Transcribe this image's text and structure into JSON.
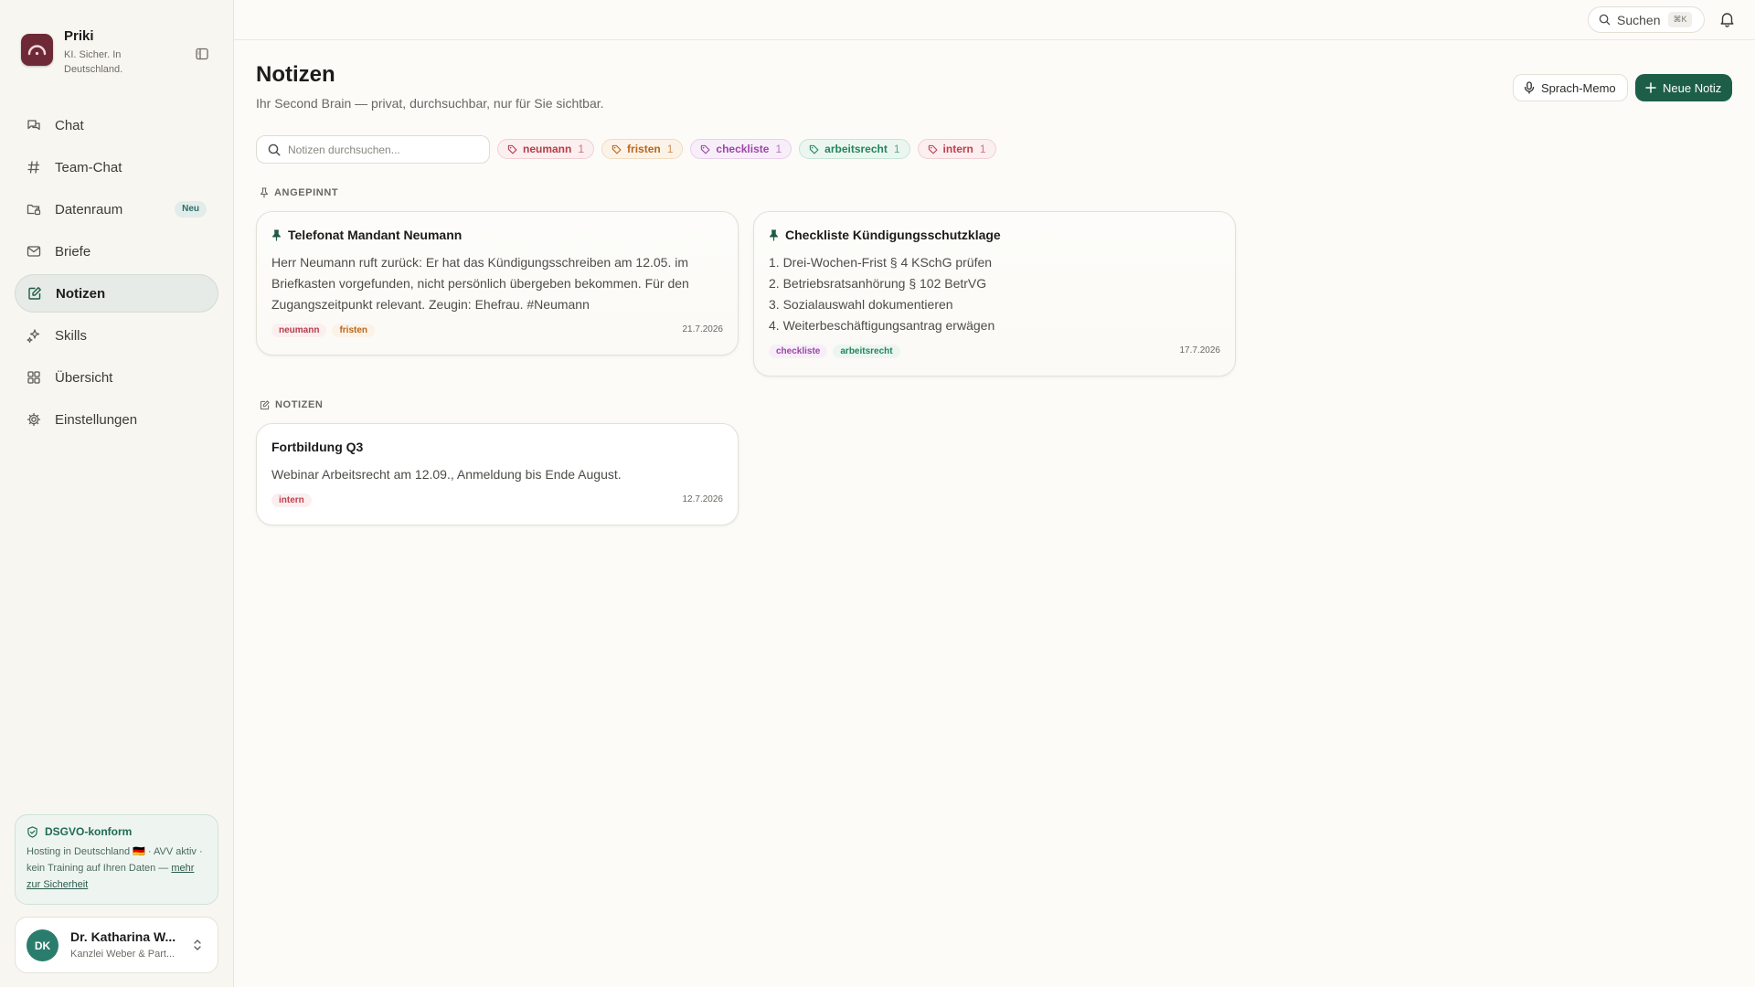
{
  "app": {
    "name": "Priki",
    "tagline": "KI. Sicher. In Deutschland."
  },
  "sidebar": {
    "items": [
      {
        "label": "Chat",
        "icon": "chat-icon"
      },
      {
        "label": "Team-Chat",
        "icon": "hash-icon"
      },
      {
        "label": "Datenraum",
        "icon": "folder-icon",
        "badge": "Neu"
      },
      {
        "label": "Briefe",
        "icon": "mail-icon"
      },
      {
        "label": "Notizen",
        "icon": "edit-note-icon",
        "active": true
      },
      {
        "label": "Skills",
        "icon": "sparkle-icon"
      },
      {
        "label": "Übersicht",
        "icon": "grid-icon"
      },
      {
        "label": "Einstellungen",
        "icon": "gear-icon"
      }
    ],
    "gdpr": {
      "title": "DSGVO-konform",
      "text": "Hosting in Deutschland 🇩🇪 · AVV aktiv · kein Training auf Ihren Daten —",
      "link": "mehr zur Sicherheit"
    },
    "user": {
      "initials": "DK",
      "name": "Dr. Katharina W...",
      "org": "Kanzlei Weber & Part..."
    }
  },
  "topbar": {
    "search_label": "Suchen",
    "search_shortcut": "⌘K"
  },
  "page": {
    "title": "Notizen",
    "subtitle": "Ihr Second Brain — privat, durchsuchbar, nur für Sie sichtbar.",
    "voice_button": "Sprach-Memo",
    "new_button": "Neue Notiz",
    "search_placeholder": "Notizen durchsuchen...",
    "tags": [
      {
        "label": "neumann",
        "count": "1",
        "color": "#b43d4a"
      },
      {
        "label": "fristen",
        "count": "1",
        "color": "#b8661b"
      },
      {
        "label": "checkliste",
        "count": "1",
        "color": "#9a47a4"
      },
      {
        "label": "arbeitsrecht",
        "count": "1",
        "color": "#23855b"
      },
      {
        "label": "intern",
        "count": "1",
        "color": "#c0404e"
      }
    ],
    "pinned_label": "ANGEPINNT",
    "notes_label": "NOTIZEN",
    "pinned": [
      {
        "title": "Telefonat Mandant Neumann",
        "body": "Herr Neumann ruft zurück: Er hat das Kündigungsschreiben am 12.05. im Briefkasten vorgefunden, nicht persönlich übergeben bekommen. Für den Zugangszeitpunkt relevant. Zeugin: Ehefrau. #Neumann",
        "tags": [
          "neumann",
          "fristen"
        ],
        "date": "21.7.2026"
      },
      {
        "title": "Checkliste Kündigungsschutzklage",
        "lines": [
          "1. Drei-Wochen-Frist § 4 KSchG prüfen",
          "2. Betriebsratsanhörung § 102 BetrVG",
          "3. Sozialauswahl dokumentieren",
          "4. Weiterbeschäftigungsantrag erwägen"
        ],
        "tags": [
          "checkliste",
          "arbeitsrecht"
        ],
        "date": "17.7.2026"
      }
    ],
    "notes": [
      {
        "title": "Fortbildung Q3",
        "body": "Webinar Arbeitsrecht am 12.09., Anmeldung bis Ende August.",
        "tags": [
          "intern"
        ],
        "date": "12.7.2026"
      }
    ]
  }
}
